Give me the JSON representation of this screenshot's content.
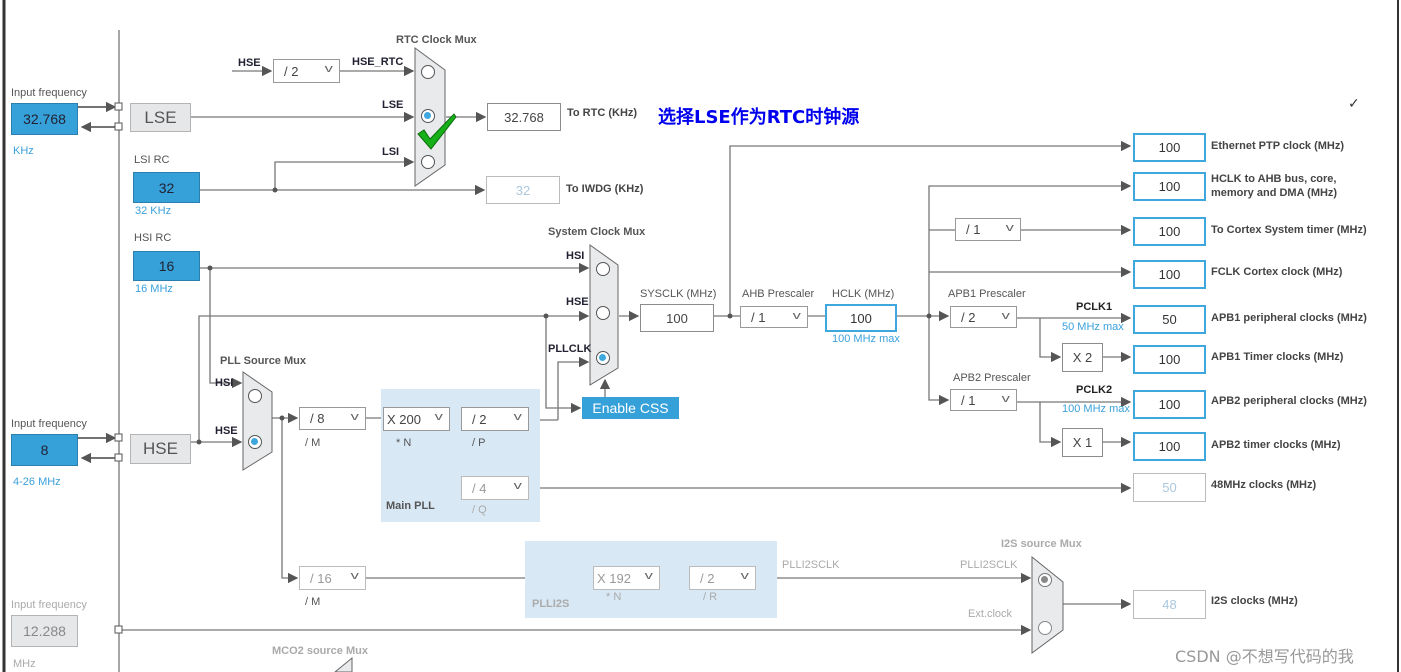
{
  "annotation": {
    "text": "选择LSE作为RTC时钟源",
    "color": "#0000ee",
    "check_icon": "green-checkmark",
    "small_check": "✓"
  },
  "watermark": "CSDN @不想写代码的我",
  "lse_input": {
    "label": "Input frequency",
    "value": "32.768",
    "unit": "KHz",
    "source": "LSE"
  },
  "lsi": {
    "label": "LSI RC",
    "value": "32",
    "unit": "32 KHz"
  },
  "hsi": {
    "label": "HSI RC",
    "value": "16",
    "unit": "16 MHz"
  },
  "hse_input": {
    "label": "Input frequency",
    "value": "8",
    "unit": "4-26 MHz",
    "source": "HSE"
  },
  "ext_input": {
    "label": "Input frequency",
    "value": "12.288",
    "unit": "MHz"
  },
  "rtc_mux": {
    "title": "RTC Clock Mux",
    "hse_label": "HSE",
    "divider": "/ 2",
    "hse_rtc": "HSE_RTC",
    "lse": "LSE",
    "lsi": "LSI",
    "selected": "LSE",
    "out_value": "32.768",
    "out_label": "To RTC (KHz)",
    "iwdg_value": "32",
    "iwdg_label": "To IWDG (KHz)"
  },
  "sys_mux": {
    "title": "System Clock Mux",
    "hsi": "HSI",
    "hse": "HSE",
    "pllclk": "PLLCLK",
    "selected": "PLLCLK",
    "enable_css": "Enable CSS"
  },
  "sysclk": {
    "label": "SYSCLK (MHz)",
    "value": "100"
  },
  "ahb": {
    "label": "AHB Prescaler",
    "value": "/ 1"
  },
  "hclk": {
    "label": "HCLK (MHz)",
    "value": "100",
    "max": "100 MHz max"
  },
  "apb1": {
    "label": "APB1 Prescaler",
    "value": "/ 2",
    "pclk": "PCLK1",
    "max": "50 MHz max",
    "mult": "X 2"
  },
  "apb2": {
    "label": "APB2 Prescaler",
    "value": "/ 1",
    "pclk": "PCLK2",
    "max": "100 MHz max",
    "mult": "X 1"
  },
  "cortex_div": "/ 1",
  "outputs": [
    {
      "value": "100",
      "label": "Ethernet PTP clock (MHz)"
    },
    {
      "value": "100",
      "label": "HCLK to AHB bus, core, memory and DMA (MHz)"
    },
    {
      "value": "100",
      "label": "To Cortex System timer (MHz)"
    },
    {
      "value": "100",
      "label": "FCLK Cortex clock (MHz)"
    },
    {
      "value": "50",
      "label": "APB1 peripheral clocks (MHz)"
    },
    {
      "value": "100",
      "label": "APB1 Timer clocks (MHz)"
    },
    {
      "value": "100",
      "label": "APB2 peripheral clocks (MHz)"
    },
    {
      "value": "100",
      "label": "APB2 timer clocks (MHz)"
    },
    {
      "value": "50",
      "label": "48MHz clocks (MHz)"
    },
    {
      "value": "48",
      "label": "I2S clocks (MHz)"
    }
  ],
  "pll_mux": {
    "title": "PLL Source Mux",
    "hsi": "HSI",
    "hse": "HSE",
    "selected": "HSE"
  },
  "main_pll": {
    "title": "Main PLL",
    "m": "/ 8",
    "m_label": "/ M",
    "n": "X 200",
    "n_label": "* N",
    "p": "/ 2",
    "p_label": "/ P",
    "q": "/ 4",
    "q_label": "/ Q"
  },
  "plli2s": {
    "title": "PLLI2S",
    "m": "/ 16",
    "m_label": "/ M",
    "n": "X 192",
    "n_label": "* N",
    "r": "/ 2",
    "r_label": "/ R",
    "clk": "PLLI2SCLK"
  },
  "i2s_mux": {
    "title": "I2S source Mux",
    "plli2sclk": "PLLI2SCLK",
    "ext": "Ext.clock",
    "selected": "PLLI2SCLK"
  },
  "mco2": {
    "title": "MCO2 source Mux"
  }
}
